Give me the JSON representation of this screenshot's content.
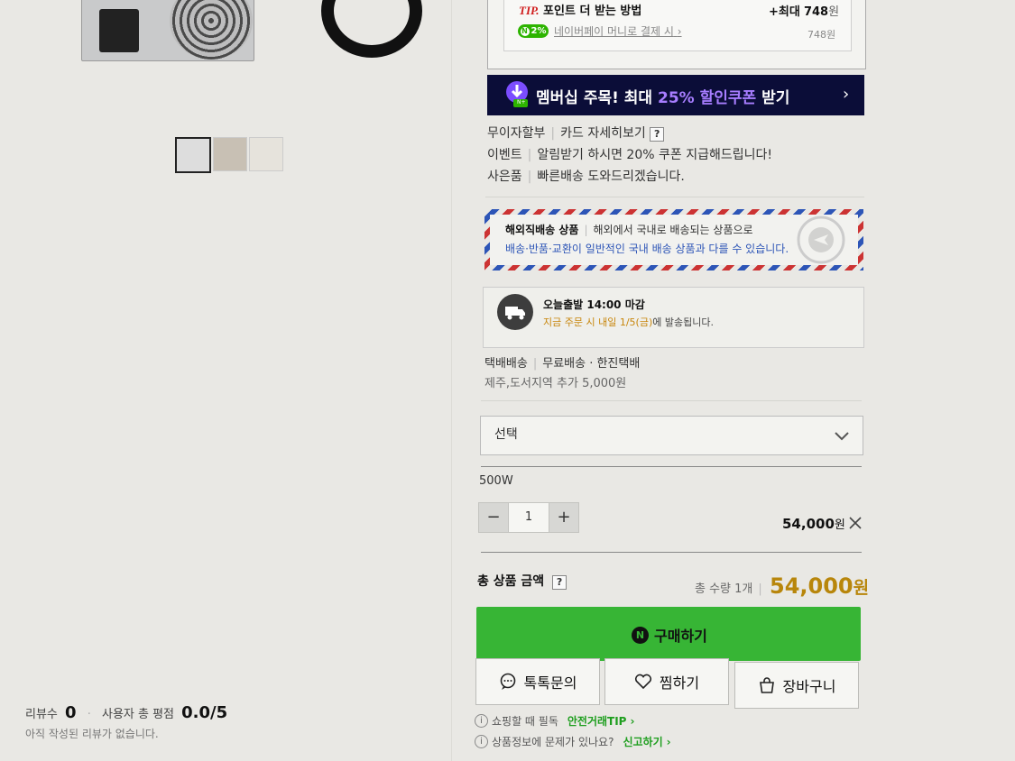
{
  "tip": {
    "title_prefix": "TIP.",
    "title": "포인트 더 받는 방법",
    "max_label": "+최대",
    "max_value": "748",
    "max_unit": "원",
    "npay_badge": "2%",
    "npay_text": "네이버페이 머니로 결제 시",
    "npay_value": "748원"
  },
  "banner": {
    "text_prefix": "멤버십 주목! 최대",
    "highlight": "25% 할인쿠폰",
    "text_suffix": "받기",
    "icon_badge": "N+"
  },
  "info": {
    "installment_label": "무이자할부",
    "installment_link": "카드 자세히보기",
    "help_mark": "?",
    "event_label": "이벤트",
    "event_text": "알림받기 하시면 20% 쿠폰 지급해드립니다!",
    "gift_label": "사은품",
    "gift_text": "빠른배송 도와드리겠습니다."
  },
  "overseas": {
    "title": "해외직배송 상품",
    "desc1": "해외에서 국내로 배송되는 상품으로",
    "desc2": "배송·반품·교환이 일반적인 국내 배송 상품과 다를 수 있습니다."
  },
  "dispatch": {
    "title": "오늘출발 14:00 마감",
    "desc_highlight": "지금 주문 시 내일 1/5(금)",
    "desc_suffix": "에 발송됩니다."
  },
  "delivery": {
    "label": "택배배송",
    "value": "무료배송 · 한진택배",
    "extra": "제주,도서지역 추가 5,000원"
  },
  "option": {
    "placeholder": "선택",
    "selected_name": "500W",
    "qty": "1",
    "minus": "−",
    "plus": "+",
    "price": "54,000",
    "price_unit": "원"
  },
  "total": {
    "label": "총 상품 금액",
    "help_mark": "?",
    "qty_text": "총 수량 1개",
    "amount": "54,000",
    "unit": "원"
  },
  "buttons": {
    "buy": "구매하기",
    "talk": "톡톡문의",
    "wish": "찜하기",
    "cart": "장바구니"
  },
  "notices": {
    "n1_text": "쇼핑할 때 필독",
    "n1_link": "안전거래TIP",
    "n2_text": "상품정보에 문제가 있나요?",
    "n2_link": "신고하기",
    "info_mark": "i"
  },
  "reviews": {
    "count_label": "리뷰수",
    "count": "0",
    "rating_label": "사용자 총 평점",
    "rating": "0.0",
    "rating_max": "/5",
    "empty_text": "아직 작성된 리뷰가 없습니다."
  },
  "colors": {
    "buy_green": "#37b535",
    "price_gold": "#b8860b",
    "banner_navy": "#0b0d38",
    "banner_highlight": "#a77dff",
    "link_green": "#1e9e1e"
  }
}
